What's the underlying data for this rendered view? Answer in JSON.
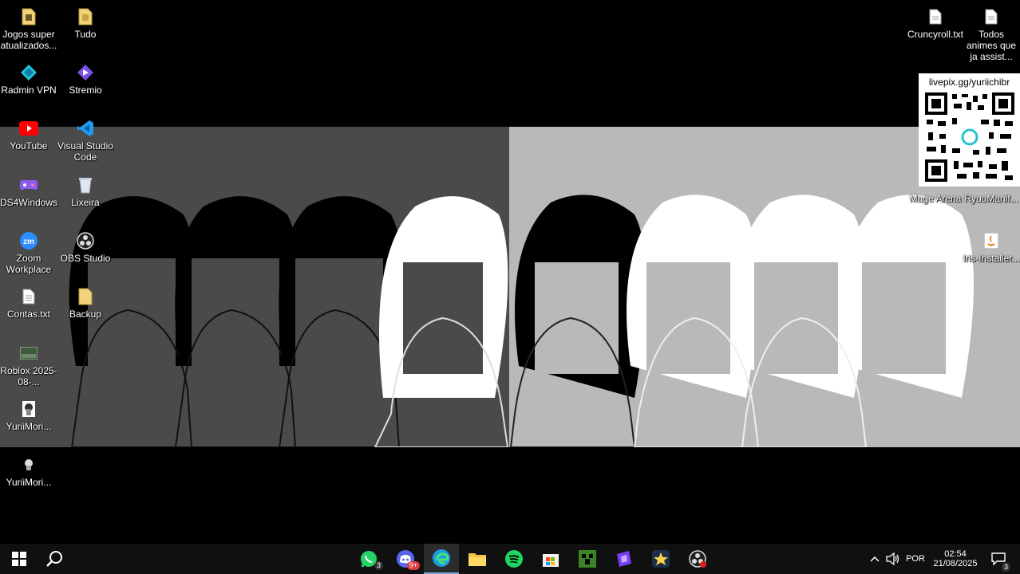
{
  "desktop_icons_left": [
    {
      "name": "Jogos super atualizados...",
      "icon": "folder-file-icon"
    },
    {
      "name": "Tudo",
      "icon": "folder-file-icon"
    },
    {
      "name": "Radmin VPN",
      "icon": "radmin-vpn-icon"
    },
    {
      "name": "Stremio",
      "icon": "stremio-icon"
    },
    {
      "name": "YouTube",
      "icon": "youtube-icon"
    },
    {
      "name": "Visual Studio Code",
      "icon": "vscode-icon"
    },
    {
      "name": "DS4Windows",
      "icon": "gamepad-icon"
    },
    {
      "name": "Lixeira",
      "icon": "recycle-bin-icon"
    },
    {
      "name": "Zoom Workplace",
      "icon": "zoom-icon"
    },
    {
      "name": "OBS Studio",
      "icon": "obs-icon"
    },
    {
      "name": "Contas.txt",
      "icon": "text-file-icon"
    },
    {
      "name": "Backup",
      "icon": "folder-icon"
    },
    {
      "name": "Roblox 2025-08-...",
      "icon": "image-file-icon"
    },
    {
      "name": "YuriiMori...",
      "icon": "image-file-icon"
    },
    {
      "name": "YuriiMori...",
      "icon": "image-file-icon"
    }
  ],
  "desktop_icons_right": [
    {
      "name": "Cruncyroll.txt",
      "icon": "text-file-icon"
    },
    {
      "name": "Todos animes que ja assist...",
      "icon": "text-file-icon"
    },
    {
      "name": "Mage Arena",
      "icon": "game-icon"
    },
    {
      "name": "RyuuManif...",
      "icon": "game-icon"
    },
    {
      "name": "Iris-Installer...",
      "icon": "java-file-icon"
    }
  ],
  "overlay": {
    "qr_url": "livepix.gg/yuriichibr"
  },
  "taskbar": {
    "pinned": [
      {
        "app": "WhatsApp",
        "icon": "whatsapp-icon",
        "badge": "3"
      },
      {
        "app": "Discord",
        "icon": "discord-icon",
        "badge": "9+"
      },
      {
        "app": "Microsoft Edge",
        "icon": "edge-icon",
        "badge": ""
      },
      {
        "app": "File Explorer",
        "icon": "file-explorer-icon",
        "badge": ""
      },
      {
        "app": "Spotify",
        "icon": "spotify-icon",
        "badge": ""
      },
      {
        "app": "Microsoft Store",
        "icon": "store-icon",
        "badge": ""
      },
      {
        "app": "Minecraft",
        "icon": "minecraft-icon",
        "badge": ""
      },
      {
        "app": "App",
        "icon": "purple-app-icon",
        "badge": ""
      },
      {
        "app": "App",
        "icon": "star-app-icon",
        "badge": ""
      },
      {
        "app": "OBS Studio",
        "icon": "obs-icon",
        "badge": ""
      }
    ],
    "language": "POR",
    "time": "02:54",
    "date": "21/08/2025",
    "notifications": "3"
  },
  "colors": {
    "taskbar": "#101010",
    "accent": "#7aa7d8"
  }
}
